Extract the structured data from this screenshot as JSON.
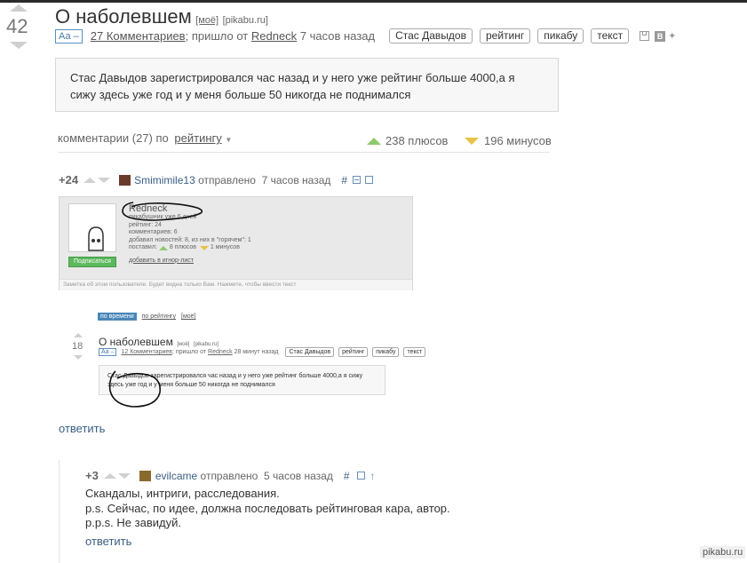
{
  "post": {
    "rating": "42",
    "title": "О наболевшем",
    "my_link": "[моё]",
    "source": "[pikabu.ru]",
    "font_toggle": "Аа –",
    "comments_link": "27 Комментариев",
    "meta_from": "; пришло от",
    "author": "Redneck",
    "time_ago": "7 часов назад",
    "tags": [
      "Стас Давыдов",
      "рейтинг",
      "пикабу",
      "текст"
    ],
    "body": "Стас Давыдов зарегистрировался час назад и у него уже рейтинг больше 4000,а я сижу здесь уже год и у меня больше 50 никогда не поднимался"
  },
  "comments_header": {
    "label": "комментарии (27) по",
    "sort_link": "рейтингу",
    "plus_text": "238 плюсов",
    "minus_text": "196 минусов"
  },
  "comment1": {
    "rating": "+24",
    "user": "Smimimile13",
    "sent_label": "отправлено",
    "time": "7 часов назад",
    "hash": "#",
    "reply": "ответить",
    "profile": {
      "username": "Redneck",
      "line1": "пикабушник уже 6 дней",
      "line2": "рейтинг: 24",
      "line3": "комментариев: 6",
      "line4": "добавил новостей: 8, из них в \"горячем\": 1",
      "votes_label": "поставил:",
      "votes_plus": "8 плюсов",
      "votes_minus": "1 минусов",
      "subscribe": "Подписаться",
      "ignore": "добавить в игнор-лист",
      "note": "Заметка об этом пользователе. Будет видна только Вам. Нажмите, чтобы ввести текст"
    },
    "embedded": {
      "sort_by_time": "по времени",
      "sort_by_rating": "по рейтингу",
      "my": "[моё]",
      "rating": "18",
      "title": "О наболевшем",
      "my_link": "[моё]",
      "source": "[pikabu.ru]",
      "font_toggle": "Аа –",
      "comments_link": "12 Комментариев",
      "meta_from": "; пришло от",
      "author": "Redneck",
      "time_ago": "28 минут назад",
      "tags": [
        "Стас Давыдов",
        "рейтинг",
        "пикабу",
        "текст"
      ],
      "body": "Стас Давыдов зарегистрировался час назад и у него уже рейтинг больше 4000,а я сижу здесь уже год и у меня больше 50 никогда не поднимался"
    }
  },
  "comment2": {
    "rating": "+3",
    "user": "evilcame",
    "sent_label": "отправлено",
    "time": "5 часов назад",
    "hash": "#",
    "lines": [
      "Скандалы, интриги, расследования.",
      "p.s. Сейчас, по идее, должна последовать рейтинговая кара, автор.",
      "p.p.s. Не завидуй."
    ],
    "reply": "ответить"
  },
  "watermark": "pikabu.ru",
  "colors": {
    "link": "#3b5f84",
    "plus": "#8fc96b",
    "minus": "#e8c24a",
    "subscribe": "#5cb85c",
    "sort_active": "#4a86b8"
  }
}
